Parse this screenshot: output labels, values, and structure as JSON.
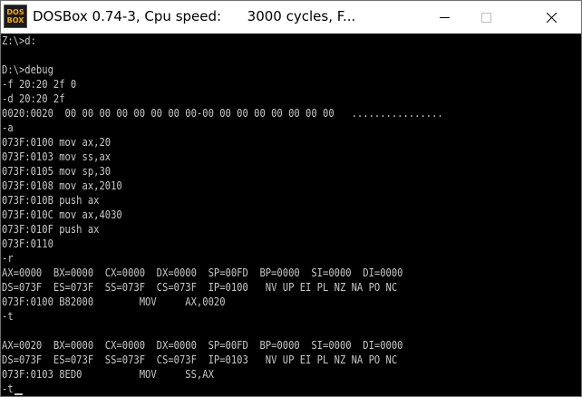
{
  "window": {
    "title": "DOSBox 0.74-3, Cpu speed:      3000 cycles, F...",
    "icon": {
      "top": "DOS",
      "bottom": "BOX",
      "color": "#f2a71b"
    }
  },
  "terminal": {
    "background": "#000000",
    "text_color": "#c8c8c8",
    "lines": [
      "Z:\\>d:",
      "",
      "D:\\>debug",
      "-f 20:20 2f 0",
      "-d 20:20 2f",
      "0020:0020  00 00 00 00 00 00 00 00-00 00 00 00 00 00 00 00   ................",
      "-a",
      "073F:0100 mov ax,20",
      "073F:0103 mov ss,ax",
      "073F:0105 mov sp,30",
      "073F:0108 mov ax,2010",
      "073F:010B push ax",
      "073F:010C mov ax,4030",
      "073F:010F push ax",
      "073F:0110",
      "-r",
      "AX=0000  BX=0000  CX=0000  DX=0000  SP=00FD  BP=0000  SI=0000  DI=0000",
      "DS=073F  ES=073F  SS=073F  CS=073F  IP=0100   NV UP EI PL NZ NA PO NC",
      "073F:0100 B82000        MOV     AX,0020",
      "-t",
      "",
      "AX=0020  BX=0000  CX=0000  DX=0000  SP=00FD  BP=0000  SI=0000  DI=0000",
      "DS=073F  ES=073F  SS=073F  CS=073F  IP=0103   NV UP EI PL NZ NA PO NC",
      "073F:0103 8ED0          MOV     SS,AX",
      "-t"
    ]
  }
}
